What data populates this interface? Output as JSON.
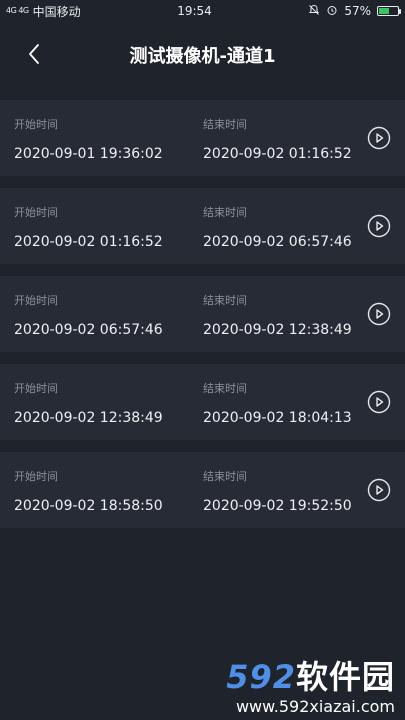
{
  "status_bar": {
    "signal": "4G 4G",
    "carrier": "中国移动",
    "time": "19:54",
    "battery": "57%",
    "battery_level": 0.57
  },
  "header": {
    "title": "测试摄像机-通道1"
  },
  "labels": {
    "start": "开始时间",
    "end": "结束时间"
  },
  "recordings": [
    {
      "start": "2020-09-01 19:36:02",
      "end": "2020-09-02 01:16:52"
    },
    {
      "start": "2020-09-02 01:16:52",
      "end": "2020-09-02 06:57:46"
    },
    {
      "start": "2020-09-02 06:57:46",
      "end": "2020-09-02 12:38:49"
    },
    {
      "start": "2020-09-02 12:38:49",
      "end": "2020-09-02 18:04:13"
    },
    {
      "start": "2020-09-02 18:58:50",
      "end": "2020-09-02 19:52:50"
    }
  ],
  "watermark": {
    "logo_number": "592",
    "logo_text": "软件园",
    "url": "www.592xiazai.com"
  },
  "colors": {
    "background": "#1f232b",
    "card": "#262b35",
    "label": "#8b929d",
    "accent": "#4f8fe8"
  }
}
